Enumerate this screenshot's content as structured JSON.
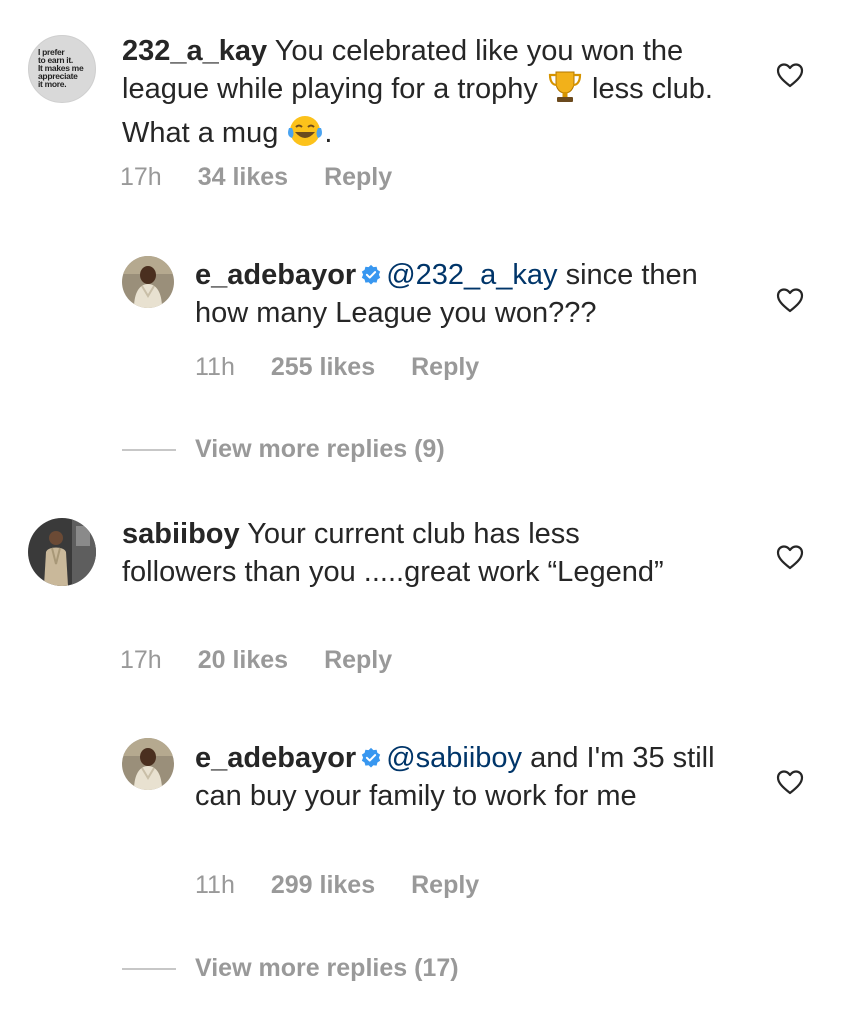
{
  "comments": [
    {
      "avatar_text": "I prefer\nto earn it.\nIt makes me\nappreciate\nit more.",
      "username": "232_a_kay",
      "text_before": "You celebrated like you won the league while playing for a trophy",
      "text_mid": " less club. What a mug",
      "text_end": ".",
      "emoji_1": "trophy-emoji",
      "emoji_2": "tears-of-joy-emoji",
      "time": "17h",
      "likes": "34 likes",
      "reply": "Reply"
    },
    {
      "username": "e_adebayor",
      "mention": "@232_a_kay",
      "text": " since then how many League you won???",
      "time": "11h",
      "likes": "255 likes",
      "reply": "Reply"
    },
    {
      "username": "sabiiboy",
      "text": "Your current club has less followers than you .....great work “Legend”",
      "time": "17h",
      "likes": "20 likes",
      "reply": "Reply"
    },
    {
      "username": "e_adebayor",
      "mention": "@sabiiboy",
      "text": " and I'm 35 still can buy your family to work for me",
      "time": "11h",
      "likes": "299 likes",
      "reply": "Reply"
    }
  ],
  "view_more": [
    "View more replies (9)",
    "View more replies (17)"
  ],
  "colors": {
    "text": "#262626",
    "meta": "#999999",
    "mention": "#003569",
    "verified": "#3897f0"
  },
  "icons": {
    "like": "heart-outline-icon",
    "verified": "verified-badge-icon"
  }
}
